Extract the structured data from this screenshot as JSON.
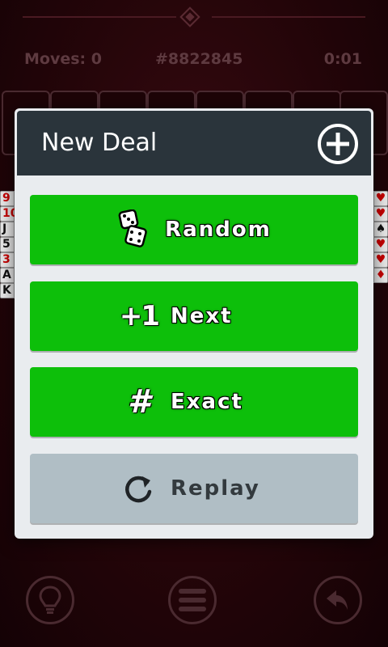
{
  "status": {
    "moves": "Moves: 0",
    "deal_number": "#8822845",
    "timer": "0:01"
  },
  "columns": {
    "left": [
      {
        "rank": "9",
        "color": "red"
      },
      {
        "rank": "10",
        "color": "red"
      },
      {
        "rank": "J",
        "color": "black"
      },
      {
        "rank": "5",
        "color": "black"
      },
      {
        "rank": "3",
        "color": "red"
      },
      {
        "rank": "A",
        "color": "black"
      },
      {
        "rank": "K",
        "color": "black"
      }
    ],
    "right_suits": [
      "♥",
      "♥",
      "♠",
      "♥",
      "♥",
      "♦"
    ]
  },
  "dialog": {
    "title": "New Deal",
    "add_icon": "plus-circle-icon",
    "buttons": [
      {
        "label": "Random",
        "icon": "dice-icon",
        "style": "green"
      },
      {
        "label": "Next",
        "icon": "plus-one-icon",
        "icon_text": "+1",
        "style": "green"
      },
      {
        "label": "Exact",
        "icon": "hash-icon",
        "icon_text": "#",
        "style": "green"
      },
      {
        "label": "Replay",
        "icon": "replay-icon",
        "style": "gray"
      }
    ]
  },
  "toolbar": {
    "hint_icon": "lightbulb-icon",
    "menu_icon": "menu-icon",
    "undo_icon": "undo-icon"
  },
  "colors": {
    "dialog_header": "#2a343b",
    "green_button": "#0dbf0a",
    "gray_button": "#b0bec5",
    "background": "#240509"
  }
}
